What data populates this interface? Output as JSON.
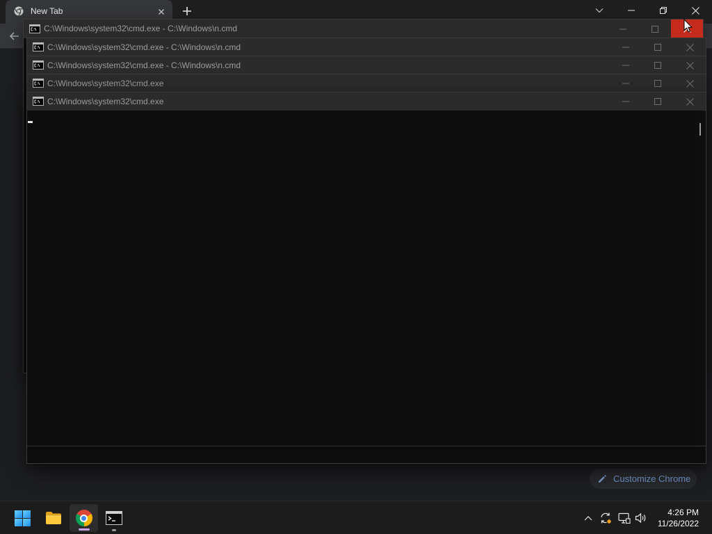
{
  "browser": {
    "tab": {
      "title": "New Tab",
      "favicon": "chrome-favicon-icon"
    },
    "toolbar": {
      "back_icon": "arrow-left-icon"
    },
    "window_controls": [
      "chevron-down-icon",
      "minimize-icon",
      "restore-icon",
      "close-icon"
    ],
    "customize_button": {
      "label": "Customize Chrome",
      "icon": "pencil-icon"
    }
  },
  "console_windows": [
    {
      "title": "C:\\Windows\\system32\\cmd.exe - C:\\Windows\\n.cmd",
      "icon": "cmd-icon",
      "close_hovered": true
    },
    {
      "title": "C:\\Windows\\system32\\cmd.exe - C:\\Windows\\n.cmd",
      "icon": "cmd-icon"
    },
    {
      "title": "C:\\Windows\\system32\\cmd.exe - C:\\Windows\\n.cmd",
      "icon": "cmd-icon"
    },
    {
      "title": "C:\\Windows\\system32\\cmd.exe",
      "icon": "cmd-icon"
    },
    {
      "title": "C:\\Windows\\system32\\cmd.exe",
      "icon": "cmd-icon"
    }
  ],
  "taskbar": {
    "apps": [
      {
        "icon": "windows-start-icon"
      },
      {
        "icon": "file-explorer-icon"
      },
      {
        "icon": "chrome-icon",
        "active": true
      },
      {
        "icon": "command-prompt-icon",
        "running": true
      }
    ],
    "tray": [
      "chevron-up-icon",
      "sync-icon",
      "network-icon",
      "speaker-icon"
    ],
    "clock": {
      "time": "4:26 PM",
      "date": "11/26/2022"
    }
  },
  "colors": {
    "close_hover": "#c42b1c",
    "console_background": "#0c0c0c",
    "title_bar": "#2b2b2b",
    "active_app_indicator": "#c9a3e6",
    "tray_badge": "#f7a11a",
    "customize_text": "#8ab4f8"
  }
}
